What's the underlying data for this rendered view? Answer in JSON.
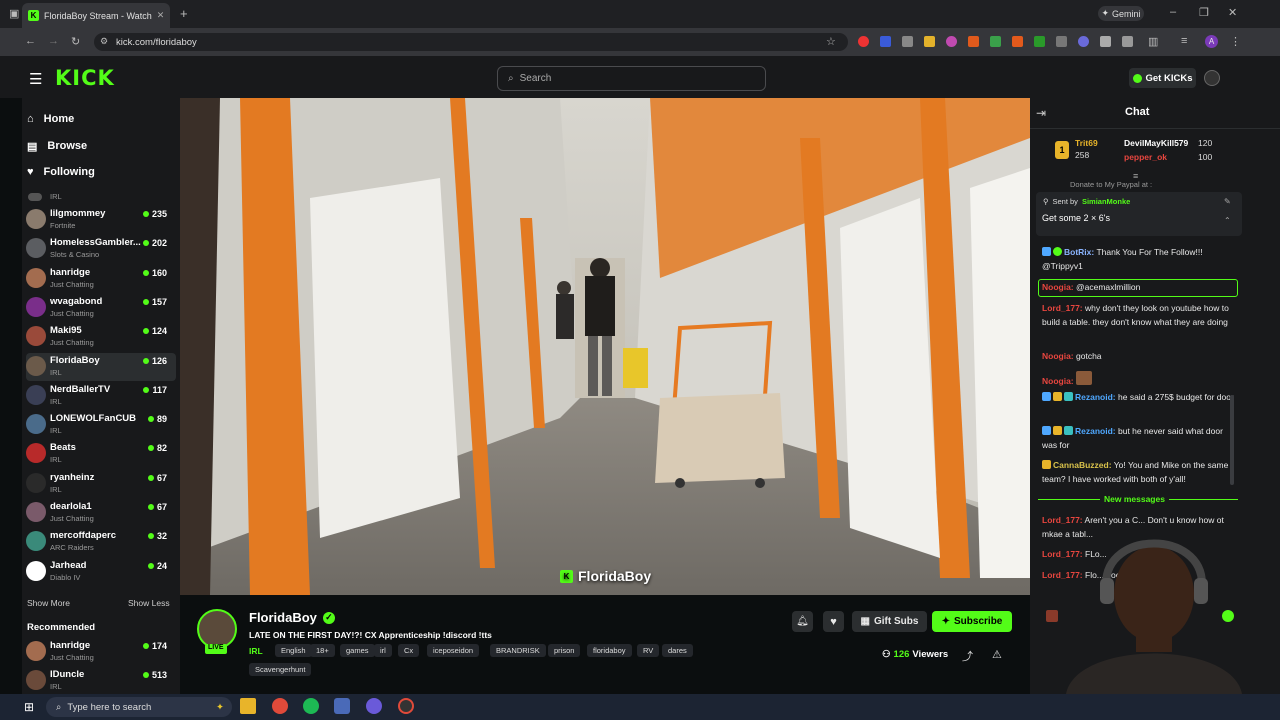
{
  "browser": {
    "tab_title": "FloridaBoy Stream - Watch",
    "url": "kick.com/floridaboy",
    "gemini_label": "Gemini"
  },
  "header": {
    "logo": "KICK",
    "search_placeholder": "Search",
    "get_kicks": "Get KICKs"
  },
  "sidebar": {
    "nav": [
      {
        "label": "Home",
        "icon": "home-icon"
      },
      {
        "label": "Browse",
        "icon": "browse-icon"
      },
      {
        "label": "Following",
        "icon": "heart-icon"
      }
    ],
    "top_category": "IRL",
    "channels": [
      {
        "name": "lilgmommey",
        "category": "Fortnite",
        "viewers": "235",
        "color": "#8a7b6d"
      },
      {
        "name": "HomelessGambler...",
        "category": "Slots & Casino",
        "viewers": "202",
        "color": "#5b5d61"
      },
      {
        "name": "hanridge",
        "category": "Just Chatting",
        "viewers": "160",
        "color": "#a36c4f"
      },
      {
        "name": "wvagabond",
        "category": "Just Chatting",
        "viewers": "157",
        "color": "#7a2e8a"
      },
      {
        "name": "Maki95",
        "category": "Just Chatting",
        "viewers": "124",
        "color": "#9a4a3a"
      },
      {
        "name": "FloridaBoy",
        "category": "IRL",
        "viewers": "126",
        "color": "#6b5a4a"
      },
      {
        "name": "NerdBallerTV",
        "category": "IRL",
        "viewers": "117",
        "color": "#3a3f55"
      },
      {
        "name": "LONEWOLFanCUB",
        "category": "IRL",
        "viewers": "89",
        "color": "#4a6b8a"
      },
      {
        "name": "Beats",
        "category": "IRL",
        "viewers": "82",
        "color": "#b82a2a"
      },
      {
        "name": "ryanheinz",
        "category": "IRL",
        "viewers": "67",
        "color": "#2a2a2a"
      },
      {
        "name": "dearlola1",
        "category": "Just Chatting",
        "viewers": "67",
        "color": "#7a5a6a"
      },
      {
        "name": "mercoffdaperc",
        "category": "ARC Raiders",
        "viewers": "32",
        "color": "#3a8a7a"
      },
      {
        "name": "Jarhead",
        "category": "Diablo IV",
        "viewers": "24",
        "color": "#ffffff"
      }
    ],
    "show_more": "Show More",
    "show_less": "Show Less",
    "recommended_title": "Recommended",
    "recommended": [
      {
        "name": "hanridge",
        "category": "Just Chatting",
        "viewers": "174",
        "color": "#a36c4f"
      },
      {
        "name": "IDuncle",
        "category": "IRL",
        "viewers": "513",
        "color": "#6a4a3a"
      }
    ]
  },
  "video": {
    "watermark": "FloridaBoy"
  },
  "stream": {
    "streamer": "FloridaBoy",
    "live_label": "LIVE",
    "title": "LATE ON THE FIRST DAY!?! CX Apprenticeship !discord !tts",
    "category": "IRL",
    "tags": [
      "English",
      "18+",
      "games",
      "irl",
      "Cx",
      "iceposeidon",
      "BRANDRISK",
      "prison",
      "floridaboy",
      "RV",
      "dares",
      "Scavengerhunt"
    ],
    "gift_subs": "Gift Subs",
    "subscribe": "Subscribe",
    "viewers": "126",
    "viewers_label": "Viewers"
  },
  "chat": {
    "title": "Chat",
    "leaderboard": [
      {
        "name": "Trit69",
        "value": "258"
      },
      {
        "name": "DevilMayKill579",
        "value": "120"
      },
      {
        "name": "pepper_ok",
        "value": "100"
      }
    ],
    "pinned_preview": "Donate to My Paypal at :",
    "pinned_sender_label": "Sent by",
    "pinned_sender": "SimianMonke",
    "pinned_text": "Get some 2 × 6's",
    "messages": [
      {
        "user": "BotRix:",
        "text": "Thank You For The Follow!!! @Trippyv1"
      },
      {
        "user": "Noogia:",
        "text": "@acemaxlmillion"
      },
      {
        "user": "Lord_177:",
        "text": "why don't they look on youtube how to build a table. they don't know what they are doing"
      },
      {
        "user": "Noogia:",
        "text": "gotcha"
      },
      {
        "user": "Noogia:",
        "text": ""
      },
      {
        "user": "Rezanoid:",
        "text": "he said a 275$ budget for door"
      },
      {
        "user": "Rezanoid:",
        "text": "but he never said what door was for"
      },
      {
        "user": "CannaBuzzed:",
        "text": "Yo! You and Mike on the same team? I have worked with both of y'all!"
      },
      {
        "user": "Lord_177:",
        "text": "Aren't you a C... Don't u know how ot mkae a tabl..."
      },
      {
        "user": "Lord_177:",
        "text": "FLo..."
      },
      {
        "user": "Lord_177:",
        "text": "Flo... doesn't know..."
      }
    ],
    "new_messages": "New messages"
  },
  "taskbar": {
    "search_placeholder": "Type here to search"
  },
  "colors": {
    "accent": "#53fc18",
    "bg": "#0b0e0f",
    "panel": "#18191b"
  }
}
